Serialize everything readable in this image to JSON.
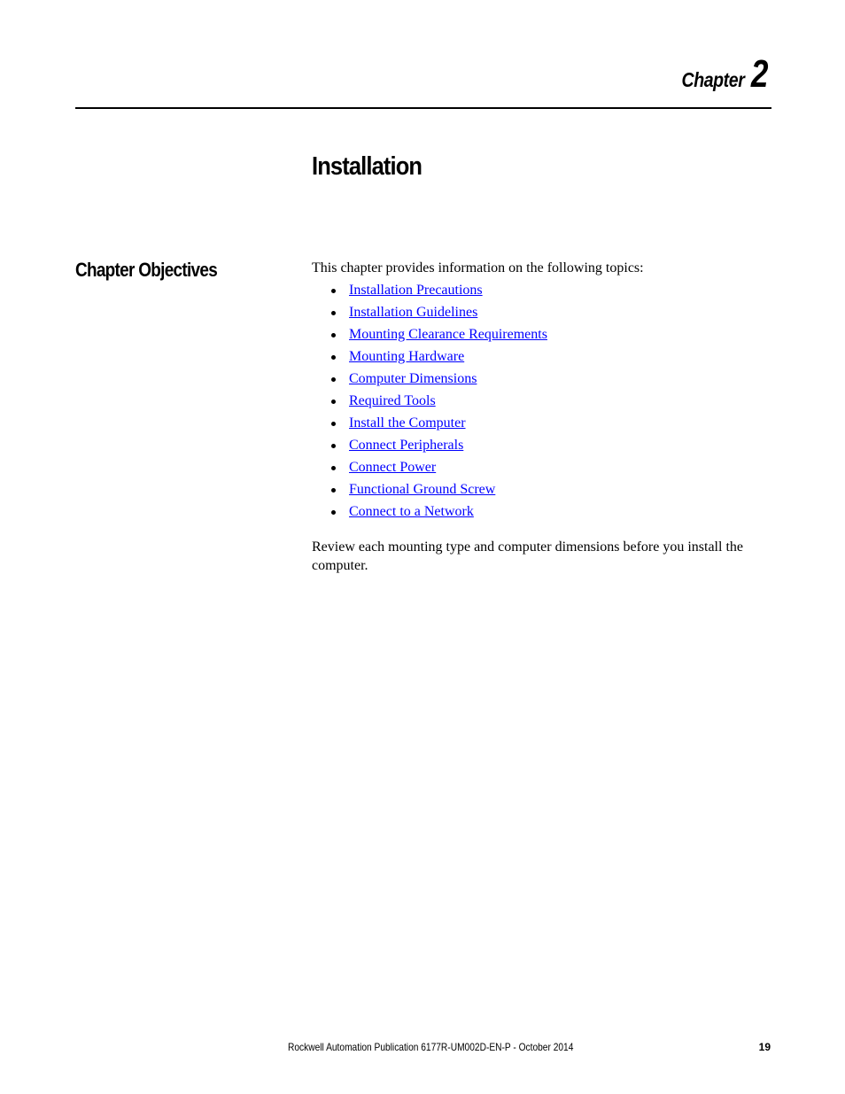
{
  "header": {
    "chapter_label": "Chapter",
    "chapter_number": "2"
  },
  "title": "Installation",
  "section": {
    "heading": "Chapter Objectives",
    "intro": "This chapter provides information on the following topics:",
    "topics": [
      "Installation Precautions",
      "Installation Guidelines",
      "Mounting Clearance Requirements",
      "Mounting Hardware",
      "Computer Dimensions",
      "Required Tools",
      "Install the Computer",
      "Connect Peripherals",
      "Connect Power",
      "Functional Ground Screw",
      "Connect to a Network"
    ],
    "closing": "Review each mounting type and computer dimensions before you install the computer."
  },
  "footer": {
    "publication": "Rockwell Automation Publication 6177R-UM002D-EN-P - October 2014",
    "page_number": "19"
  },
  "colors": {
    "link": "#0000ff",
    "text": "#000000"
  }
}
